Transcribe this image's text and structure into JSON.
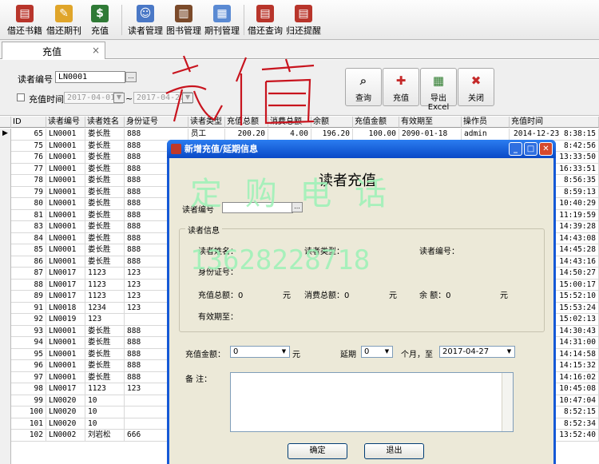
{
  "toolbar": {
    "items": [
      {
        "label": "借还书籍",
        "icon": "book-return-icon",
        "color": "#b8352b"
      },
      {
        "label": "借还期刊",
        "icon": "magazine-icon",
        "color": "#e0a52a"
      },
      {
        "label": "充值",
        "icon": "dollar-icon",
        "color": "#2f7a36"
      },
      {
        "label": "读者管理",
        "icon": "readers-icon",
        "color": "#4a78c6"
      },
      {
        "label": "图书管理",
        "icon": "books-icon",
        "color": "#7b4a2a"
      },
      {
        "label": "期刊管理",
        "icon": "document-icon",
        "color": "#5a8ad3"
      },
      {
        "label": "借还查询",
        "icon": "query-book-icon",
        "color": "#b8352b"
      },
      {
        "label": "归还提醒",
        "icon": "reminder-icon",
        "color": "#b8352b"
      }
    ]
  },
  "tab": {
    "label": "充值",
    "close": "×"
  },
  "search": {
    "reader_no_label": "读者编号",
    "reader_no_value": "LN0001",
    "recharge_time_label": "充值时间",
    "date_from": "2017-04-01",
    "tilde": "~",
    "date_to": "2017-04-27",
    "browse": "..."
  },
  "actions": {
    "query": "查询",
    "recharge": "充值",
    "export": "导出Excel",
    "close": "关闭"
  },
  "table": {
    "headers": [
      "ID",
      "读者编号",
      "读者姓名",
      "身份证号",
      "读者类型",
      "充值总额",
      "消费总额",
      "余额",
      "充值金额",
      "有效期至",
      "操作员",
      "充值时间"
    ],
    "rows": [
      [
        "65",
        "LN0001",
        "娄长胜",
        "888",
        "员工",
        "200.20",
        "4.00",
        "196.20",
        "100.00",
        "2090-01-18",
        "admin",
        "2014-12-23  8:38:15"
      ],
      [
        "75",
        "LN0001",
        "娄长胜",
        "888",
        "",
        "",
        "",
        "",
        "",
        "",
        "",
        "8:42:56"
      ],
      [
        "76",
        "LN0001",
        "娄长胜",
        "888",
        "",
        "",
        "",
        "",
        "",
        "",
        "",
        "13:33:50"
      ],
      [
        "77",
        "LN0001",
        "娄长胜",
        "888",
        "",
        "",
        "",
        "",
        "",
        "",
        "",
        "16:33:51"
      ],
      [
        "78",
        "LN0001",
        "娄长胜",
        "888",
        "",
        "",
        "",
        "",
        "",
        "",
        "",
        "8:56:35"
      ],
      [
        "79",
        "LN0001",
        "娄长胜",
        "888",
        "",
        "",
        "",
        "",
        "",
        "",
        "",
        "8:59:13"
      ],
      [
        "80",
        "LN0001",
        "娄长胜",
        "888",
        "",
        "",
        "",
        "",
        "",
        "",
        "",
        "10:40:29"
      ],
      [
        "81",
        "LN0001",
        "娄长胜",
        "888",
        "",
        "",
        "",
        "",
        "",
        "",
        "",
        "11:19:59"
      ],
      [
        "83",
        "LN0001",
        "娄长胜",
        "888",
        "",
        "",
        "",
        "",
        "",
        "",
        "",
        "14:39:28"
      ],
      [
        "84",
        "LN0001",
        "娄长胜",
        "888",
        "",
        "",
        "",
        "",
        "",
        "",
        "",
        "14:43:08"
      ],
      [
        "85",
        "LN0001",
        "娄长胜",
        "888",
        "",
        "",
        "",
        "",
        "",
        "",
        "",
        "14:45:28"
      ],
      [
        "86",
        "LN0001",
        "娄长胜",
        "888",
        "",
        "",
        "",
        "",
        "",
        "",
        "",
        "14:43:16"
      ],
      [
        "87",
        "LN0017",
        "1123",
        "123",
        "",
        "",
        "",
        "",
        "",
        "",
        "",
        "14:50:27"
      ],
      [
        "88",
        "LN0017",
        "1123",
        "123",
        "",
        "",
        "",
        "",
        "",
        "",
        "",
        "15:00:17"
      ],
      [
        "89",
        "LN0017",
        "1123",
        "123",
        "",
        "",
        "",
        "",
        "",
        "",
        "",
        "15:52:10"
      ],
      [
        "91",
        "LN0018",
        "1234",
        "123",
        "",
        "",
        "",
        "",
        "",
        "",
        "",
        "15:53:24"
      ],
      [
        "92",
        "LN0019",
        "123",
        "",
        "",
        "",
        "",
        "",
        "",
        "",
        "",
        "15:02:13"
      ],
      [
        "93",
        "LN0001",
        "娄长胜",
        "888",
        "",
        "",
        "",
        "",
        "",
        "",
        "",
        "14:30:43"
      ],
      [
        "94",
        "LN0001",
        "娄长胜",
        "888",
        "",
        "",
        "",
        "",
        "",
        "",
        "",
        "14:31:00"
      ],
      [
        "95",
        "LN0001",
        "娄长胜",
        "888",
        "",
        "",
        "",
        "",
        "",
        "",
        "",
        "14:14:58"
      ],
      [
        "96",
        "LN0001",
        "娄长胜",
        "888",
        "",
        "",
        "",
        "",
        "",
        "",
        "",
        "14:15:32"
      ],
      [
        "97",
        "LN0001",
        "娄长胜",
        "888",
        "",
        "",
        "",
        "",
        "",
        "",
        "",
        "14:16:02"
      ],
      [
        "98",
        "LN0017",
        "1123",
        "123",
        "",
        "",
        "",
        "",
        "",
        "",
        "",
        "10:45:08"
      ],
      [
        "99",
        "LN0020",
        "10",
        "",
        "",
        "",
        "",
        "",
        "",
        "",
        "",
        "10:47:04"
      ],
      [
        "100",
        "LN0020",
        "10",
        "",
        "",
        "",
        "",
        "",
        "",
        "",
        "",
        "8:52:15"
      ],
      [
        "101",
        "LN0020",
        "10",
        "",
        "",
        "",
        "",
        "",
        "",
        "",
        "",
        "8:52:34"
      ],
      [
        "102",
        "LN0002",
        "刘岩松",
        "666",
        "",
        "",
        "",
        "",
        "",
        "",
        "",
        "13:52:40"
      ]
    ]
  },
  "dialog": {
    "title": "新增充值/延期信息",
    "heading": "读者充值",
    "reader_no_label": "读者编号",
    "browse": "...",
    "group_label": "读者信息",
    "name_label": "读者姓名：",
    "type_label": "读者类型：",
    "no_label": "读者编号：",
    "id_label": "身份证号：",
    "total_label": "充值总额：0",
    "unit1": "元",
    "consume_label": "消费总额：0",
    "unit2": "元",
    "balance_label": "余    额：0",
    "unit3": "元",
    "expire_label": "有效期至：",
    "amount_label": "充值金额：",
    "amount_value": "0",
    "amount_unit": "元",
    "extend_label": "延期",
    "extend_value": "0",
    "extend_unit": "个月，至",
    "extend_date": "2017-04-27",
    "remark_label": "备    注：",
    "ok": "确定",
    "exit": "退出"
  },
  "watermarks": {
    "line1": "定 购 电 话",
    "line2": "13628228718",
    "handwriting": "充值"
  }
}
